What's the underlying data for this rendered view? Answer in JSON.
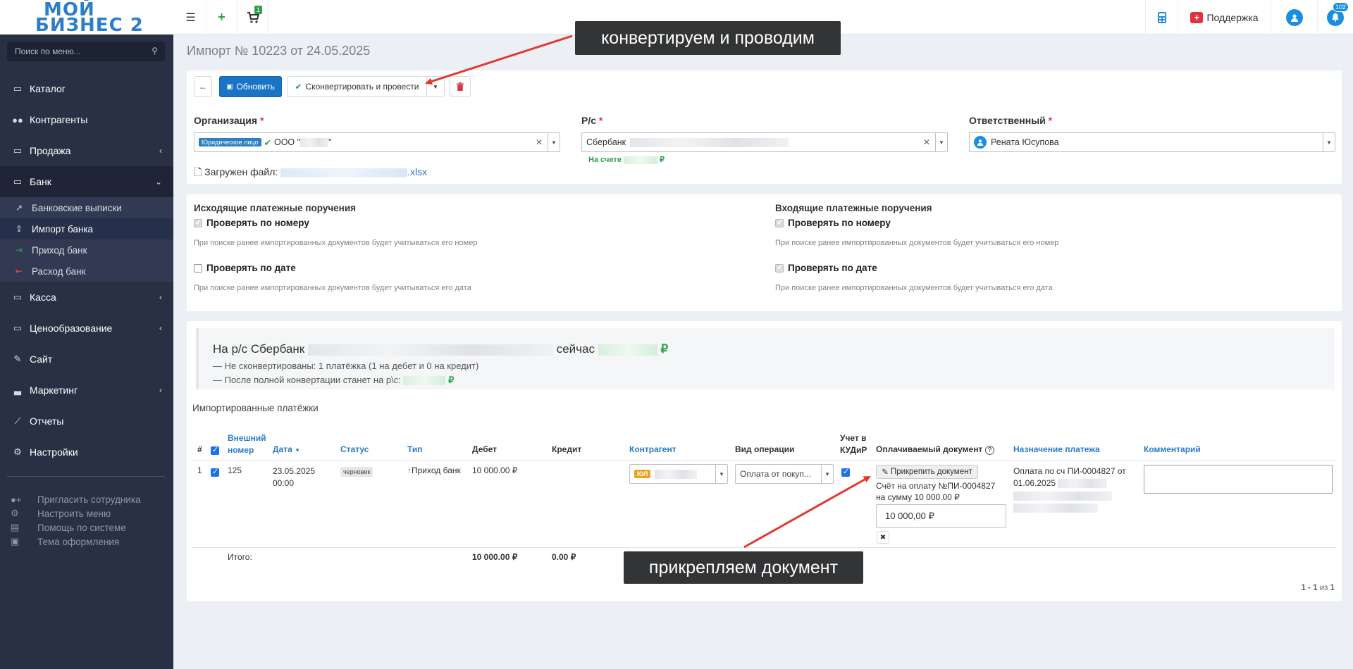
{
  "topbar": {
    "logo_line1": "МОЙ",
    "logo_line2": "БИЗНЕС 2",
    "cart_count": "1",
    "support_label": "Поддержка",
    "bell_count": "102"
  },
  "sidebar": {
    "search_placeholder": "Поиск по меню...",
    "items": [
      {
        "label": "Каталог",
        "icon": "folder-icon"
      },
      {
        "label": "Контрагенты",
        "icon": "users-icon"
      },
      {
        "label": "Продажа",
        "icon": "folder-icon"
      },
      {
        "label": "Банк",
        "icon": "folder-icon"
      },
      {
        "label": "Касса",
        "icon": "folder-icon"
      },
      {
        "label": "Ценообразование",
        "icon": "folder-icon"
      },
      {
        "label": "Сайт",
        "icon": "magic-icon"
      },
      {
        "label": "Маркетинг",
        "icon": "chart-icon"
      },
      {
        "label": "Отчеты",
        "icon": "line-chart-icon"
      },
      {
        "label": "Настройки",
        "icon": "gear-icon"
      }
    ],
    "bank_sub": [
      {
        "label": "Банковские выписки"
      },
      {
        "label": "Импорт банка"
      },
      {
        "label": "Приход банк"
      },
      {
        "label": "Расход банк"
      }
    ],
    "bottom": [
      {
        "label": "Пригласить сотрудника"
      },
      {
        "label": "Настроить меню"
      },
      {
        "label": "Помощь по системе"
      },
      {
        "label": "Тема оформления"
      }
    ]
  },
  "page": {
    "title": "Импорт № 10223 от 24.05.2025"
  },
  "toolbar": {
    "refresh_label": "Обновить",
    "convert_label": "Сконвертировать и провести"
  },
  "form": {
    "org_label": "Организация",
    "org_badge": "Юридическое лицо",
    "org_value": "ООО \"",
    "org_value_end": "\"",
    "account_label": "Р/с",
    "account_value": "Сбербанк",
    "on_account_label": "На счете",
    "currency": "₽",
    "responsible_label": "Ответственный",
    "responsible_value": "Рената Юсупова",
    "file_label": "Загружен файл:",
    "file_ext": ".xlsx",
    "required_mark": "*"
  },
  "options": {
    "outgoing_title": "Исходящие платежные поручения",
    "incoming_title": "Входящие платежные поручения",
    "check_number": "Проверять по номеру",
    "check_number_hint": "При поиске ранее импортированных документов будет учитываться его номер",
    "check_date": "Проверять по дате",
    "check_date_hint": "При поиске ранее импортированных документов будет учитываться его дата"
  },
  "summary": {
    "line1_prefix": "На р/с Сбербанк",
    "line1_mid": "сейчас",
    "line2": "—  Не сконвертированы: 1 платёжка (1 на дебет и 0 на кредит)",
    "line3": "—  После полной конвертации станет на р\\с:",
    "currency": "₽",
    "section_title": "Импортированные платёжки"
  },
  "table": {
    "headers": {
      "num": "#",
      "ext_num_1": "Внешний",
      "ext_num_2": "номер",
      "date": "Дата",
      "status": "Статус",
      "type": "Тип",
      "debit": "Дебет",
      "credit": "Кредит",
      "counterparty": "Контрагент",
      "operation": "Вид операции",
      "kudir_1": "Учет в",
      "kudir_2": "КУДиР",
      "paid_doc": "Оплачиваемый документ",
      "purpose": "Назначение платежа",
      "comment": "Комментарий"
    },
    "rows": [
      {
        "num": "1",
        "ext_num": "125",
        "date_1": "23.05.2025",
        "date_2": "00:00",
        "status": "черновик",
        "type": "Приход банк",
        "debit": "10 000.00 ₽",
        "credit": "",
        "counterparty_badge": "ЮЛ",
        "operation": "Оплата от покуп...",
        "attach_label": "Прикрепить документ",
        "doc_link": "Счёт на оплату №ПИ-0004827",
        "doc_sum": "на сумму 10 000.00 ₽",
        "amount_input": "10 000,00 ₽",
        "purpose_1": "Оплата по сч ПИ-0004827 от",
        "purpose_2": "01.06.2025"
      }
    ],
    "total_label": "Итого:",
    "total_debit": "10 000.00 ₽",
    "total_credit": "0.00 ₽",
    "pagination_range": "1 - 1",
    "pagination_of": "из",
    "pagination_total": "1"
  },
  "annotations": {
    "top": "конвертируем и проводим",
    "bottom": "прикрепляем документ"
  },
  "colors": {
    "sidebar_bg": "#283044",
    "primary": "#1b73c6",
    "link": "#1f78c8",
    "success": "#2ea049",
    "danger": "#d9363e",
    "annotation_arrow": "#e03a2f"
  }
}
